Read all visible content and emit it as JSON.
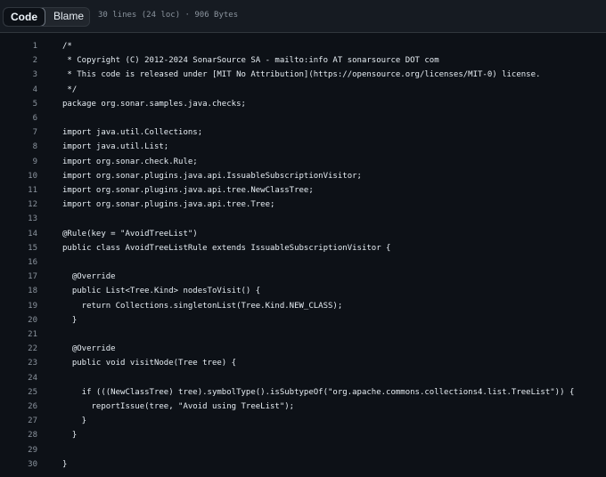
{
  "toolbar": {
    "code_label": "Code",
    "blame_label": "Blame",
    "file_info": "30 lines (24 loc) · 906 Bytes"
  },
  "code": {
    "lines": [
      "/*",
      " * Copyright (C) 2012-2024 SonarSource SA - mailto:info AT sonarsource DOT com",
      " * This code is released under [MIT No Attribution](https://opensource.org/licenses/MIT-0) license.",
      " */",
      "package org.sonar.samples.java.checks;",
      "",
      "import java.util.Collections;",
      "import java.util.List;",
      "import org.sonar.check.Rule;",
      "import org.sonar.plugins.java.api.IssuableSubscriptionVisitor;",
      "import org.sonar.plugins.java.api.tree.NewClassTree;",
      "import org.sonar.plugins.java.api.tree.Tree;",
      "",
      "@Rule(key = \"AvoidTreeList\")",
      "public class AvoidTreeListRule extends IssuableSubscriptionVisitor {",
      "",
      "  @Override",
      "  public List<Tree.Kind> nodesToVisit() {",
      "    return Collections.singletonList(Tree.Kind.NEW_CLASS);",
      "  }",
      "",
      "  @Override",
      "  public void visitNode(Tree tree) {",
      "",
      "    if (((NewClassTree) tree).symbolType().isSubtypeOf(\"org.apache.commons.collections4.list.TreeList\")) {",
      "      reportIssue(tree, \"Avoid using TreeList\");",
      "    }",
      "  }",
      "",
      "}"
    ]
  }
}
